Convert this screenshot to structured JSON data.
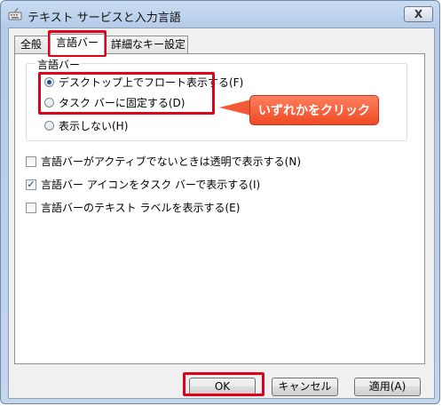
{
  "window": {
    "title": "テキスト サービスと入力言語",
    "close_label": "X"
  },
  "tabs": [
    {
      "label": "全般"
    },
    {
      "label": "言語バー"
    },
    {
      "label": "詳細なキー設定"
    }
  ],
  "group": {
    "label": "言語バー",
    "options": [
      {
        "label": "デスクトップ上でフロート表示する(F)",
        "selected": true
      },
      {
        "label": "タスク バーに固定する(D)",
        "selected": false
      },
      {
        "label": "表示しない(H)",
        "selected": false
      }
    ]
  },
  "checkboxes": [
    {
      "label": "言語バーがアクティブでないときは透明で表示する(N)",
      "checked": false
    },
    {
      "label": "言語バー アイコンをタスク バーで表示する(I)",
      "checked": true
    },
    {
      "label": "言語バーのテキスト ラベルを表示する(E)",
      "checked": false
    }
  ],
  "buttons": {
    "ok": "OK",
    "cancel": "キャンセル",
    "apply": "適用(A)"
  },
  "callout": {
    "text": "いずれかをクリック"
  },
  "colors": {
    "highlight": "#e0001a",
    "callout": "#f05a35"
  }
}
